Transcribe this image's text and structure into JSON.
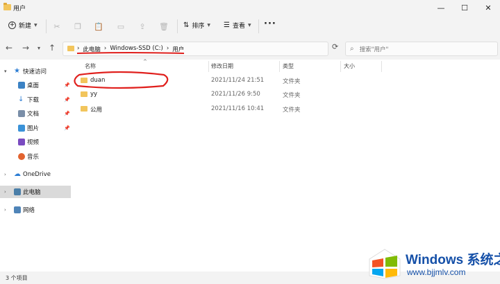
{
  "window": {
    "title": "用户"
  },
  "window_controls": {
    "minimize": "—",
    "maximize": "☐",
    "close": "✕"
  },
  "toolbar": {
    "new_label": "新建",
    "sort_label": "排序",
    "view_label": "查看",
    "more_label": "···"
  },
  "address": {
    "crumbs": [
      "›",
      "此电脑",
      "›",
      "Windows-SSD (C:)",
      "›",
      "用户"
    ]
  },
  "search": {
    "placeholder": "搜索\"用户\""
  },
  "sidebar": {
    "quick_access": "快速访问",
    "items": [
      {
        "label": "桌面",
        "icon": "desktop-icon",
        "color": "#3b82c4"
      },
      {
        "label": "下载",
        "icon": "download-icon",
        "color": "#2b7cd3"
      },
      {
        "label": "文档",
        "icon": "document-icon",
        "color": "#7a8ea8"
      },
      {
        "label": "图片",
        "icon": "pictures-icon",
        "color": "#3a92d8"
      },
      {
        "label": "视频",
        "icon": "video-icon",
        "color": "#7a4bc0"
      },
      {
        "label": "音乐",
        "icon": "music-icon",
        "color": "#e2632f"
      }
    ],
    "onedrive": "OneDrive",
    "thispc": "此电脑",
    "network": "网络"
  },
  "columns": {
    "name": "名称",
    "modified": "修改日期",
    "type": "类型",
    "size": "大小"
  },
  "rows": [
    {
      "name": "duan",
      "modified": "2021/11/24 21:51",
      "type": "文件夹"
    },
    {
      "name": "yy",
      "modified": "2021/11/26 9:50",
      "type": "文件夹"
    },
    {
      "name": "公用",
      "modified": "2021/11/16 10:41",
      "type": "文件夹"
    }
  ],
  "status": {
    "count": "3 个项目"
  },
  "watermark": {
    "brand": "Windows 系统之家",
    "url": "www.bjjmlv.com"
  },
  "colors": {
    "annotation": "#e0201d",
    "folder": "#f2c55c",
    "watermark": "#1550a8"
  }
}
